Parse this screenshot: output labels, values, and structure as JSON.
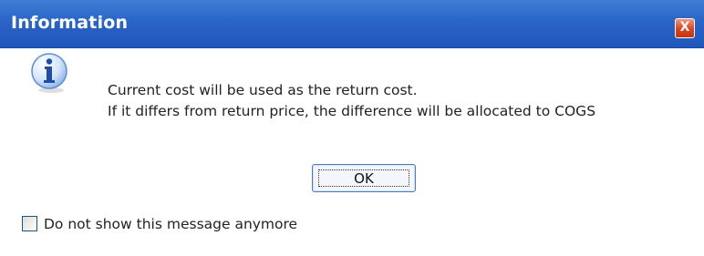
{
  "dialog": {
    "title": "Information",
    "close_glyph": "X",
    "icon": "info-icon",
    "message_line_1": "Current cost will be used as the return cost.",
    "message_line_2": "If it differs from return price, the difference will be allocated to COGS",
    "ok_label": "OK",
    "checkbox_label": "Do not show this message anymore",
    "checkbox_checked": false
  },
  "colors": {
    "titlebar": "#2a64c5",
    "close_button": "#d9441f",
    "ok_border": "#4c7fbf"
  }
}
